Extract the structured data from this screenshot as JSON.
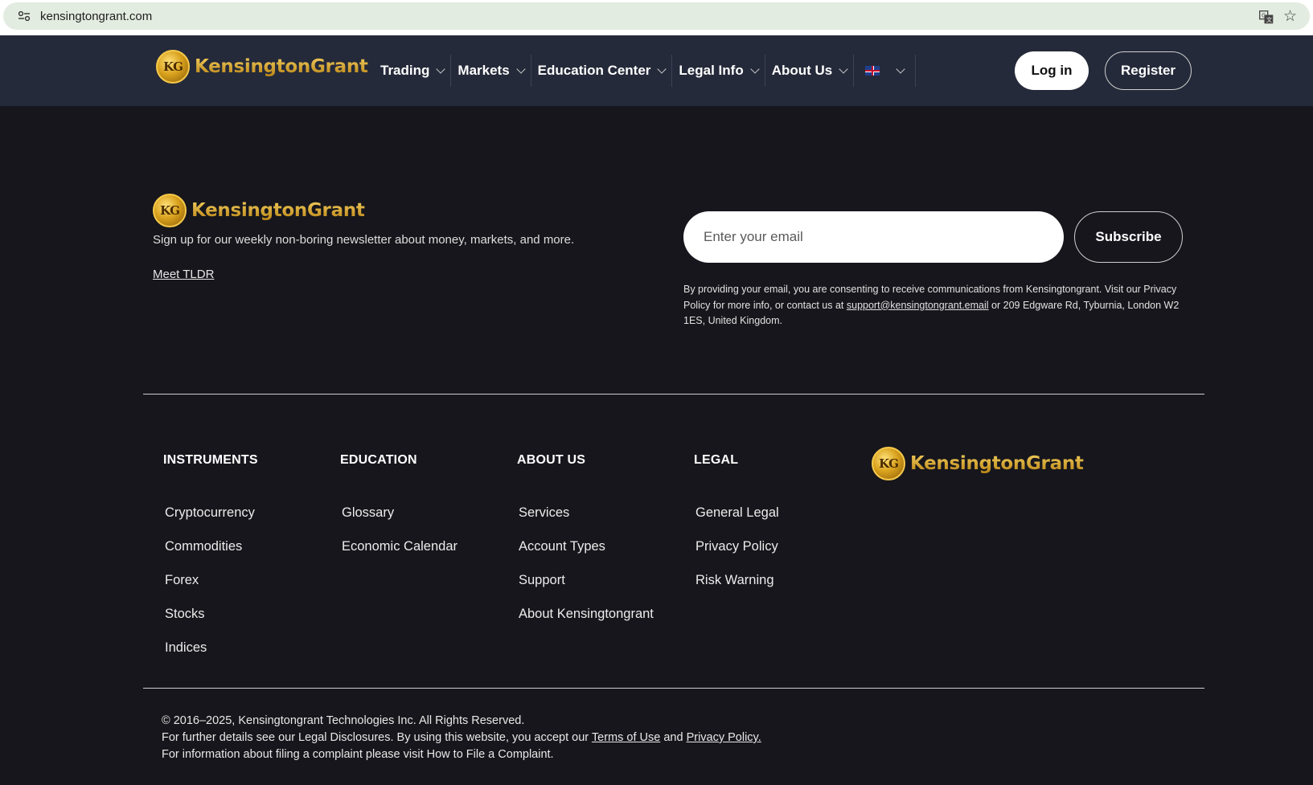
{
  "browser": {
    "url": "kensingtongrant.com",
    "site_settings_icon": "site-settings-icon",
    "translate_icon": "translate-icon",
    "bookmark_icon": "star-icon",
    "star_glyph": "☆"
  },
  "brand": {
    "coin_text": "KG",
    "name": "KensingtonGrant",
    "gold": "#caa030",
    "header_bg": "#252a3a",
    "page_bg": "#16161c"
  },
  "nav": {
    "items": [
      {
        "label": "Trading"
      },
      {
        "label": "Markets"
      },
      {
        "label": "Education Center"
      },
      {
        "label": "Legal Info"
      },
      {
        "label": "About Us"
      }
    ],
    "language_icon": "uk-flag-icon",
    "login_label": "Log in",
    "register_label": "Register"
  },
  "newsletter": {
    "tagline": "Sign up for our weekly non-boring newsletter about money, markets, and more.",
    "meet_link": "Meet TLDR",
    "email_placeholder": "Enter your email",
    "subscribe_label": "Subscribe",
    "consent_before": "By providing your email, you are consenting to receive communications from Kensingtongrant. Visit our Privacy Policy for more info, or contact us at ",
    "consent_email": "support@kensingtongrant.email",
    "consent_after": " or 209 Edgware Rd, Tyburnia, London W2 1ES, United Kingdom."
  },
  "footer_columns": [
    {
      "heading": "INSTRUMENTS",
      "links": [
        "Cryptocurrency",
        "Commodities",
        "Forex",
        "Stocks",
        "Indices"
      ]
    },
    {
      "heading": "EDUCATION",
      "links": [
        "Glossary",
        "Economic Calendar"
      ]
    },
    {
      "heading": "ABOUT US",
      "links": [
        "Services",
        "Account Types",
        "Support",
        "About Kensingtongrant"
      ]
    },
    {
      "heading": "LEGAL",
      "links": [
        "General Legal",
        "Privacy Policy",
        "Risk Warning"
      ]
    }
  ],
  "legal": {
    "copyright": "© 2016–2025, Kensingtongrant Technologies Inc. All Rights Reserved.",
    "disclosure_before": "For further details see our Legal Disclosures. By using this website, you accept our ",
    "terms_link": "Terms of Use",
    "and_text": " and ",
    "privacy_link": "Privacy Policy.",
    "complaint": "For information about filing a complaint please visit How to File a Complaint."
  }
}
